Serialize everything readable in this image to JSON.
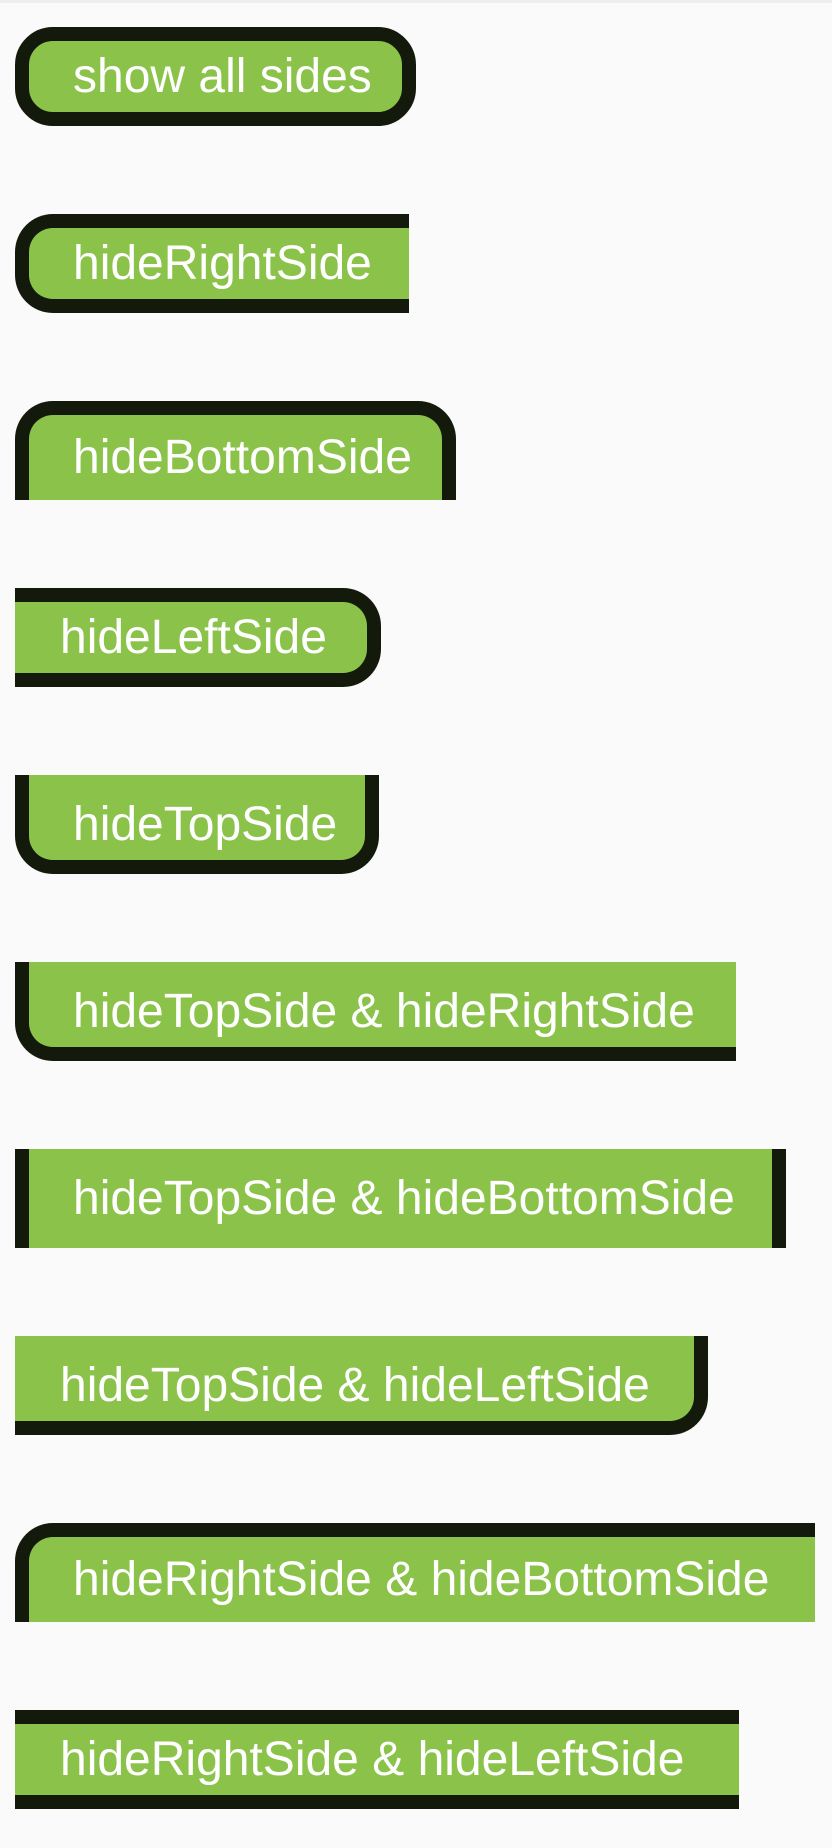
{
  "colors": {
    "background": "#fafafa",
    "chip_fill": "#8bc34a",
    "chip_border": "#141a0b",
    "chip_text": "#ffffff"
  },
  "buttons": [
    {
      "label": "show all sides"
    },
    {
      "label": "hideRightSide"
    },
    {
      "label": "hideBottomSide"
    },
    {
      "label": "hideLeftSide"
    },
    {
      "label": "hideTopSide"
    },
    {
      "label": "hideTopSide & hideRightSide"
    },
    {
      "label": "hideTopSide & hideBottomSide"
    },
    {
      "label": "hideTopSide & hideLeftSide"
    },
    {
      "label": "hideRightSide & hideBottomSide"
    },
    {
      "label": "hideRightSide & hideLeftSide"
    }
  ]
}
